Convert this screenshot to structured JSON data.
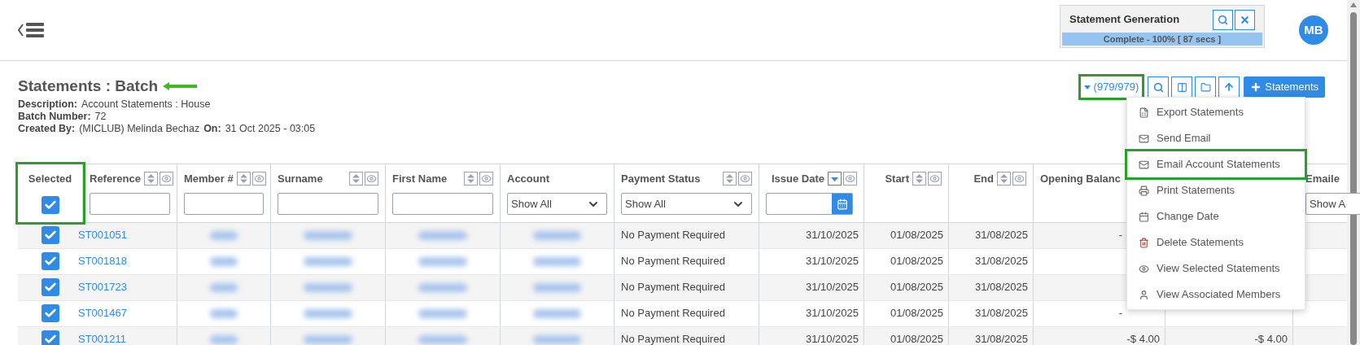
{
  "header": {
    "avatar": "MB",
    "job": {
      "title": "Statement Generation",
      "status": "Complete - 100% [ 87 secs ]",
      "level": 1
    }
  },
  "page": {
    "title": "Statements : Batch",
    "details": [
      {
        "label": "Description:",
        "value": "Account Statements : House"
      },
      {
        "label": "Batch Number:",
        "value": "72"
      },
      {
        "label": "Created By:",
        "value": "(MICLUB) Melinda Bechaz",
        "label2": "On:",
        "value2": "31 Oct 2025 - 03:05"
      }
    ]
  },
  "toolbar": {
    "count": "(979/979)",
    "add_button": "Statements"
  },
  "menu": [
    {
      "kind": "export",
      "label": "Export Statements",
      "highlighted": false
    },
    {
      "kind": "mail",
      "label": "Send Email",
      "highlighted": false
    },
    {
      "kind": "mail",
      "label": "Email Account Statements",
      "highlighted": true
    },
    {
      "kind": "print",
      "label": "Print Statements",
      "highlighted": false
    },
    {
      "kind": "calendar",
      "label": "Change Date",
      "highlighted": false
    },
    {
      "kind": "delete",
      "label": "Delete Statements",
      "highlighted": false
    },
    {
      "kind": "view",
      "label": "View Selected Statements",
      "highlighted": false
    },
    {
      "kind": "user",
      "label": "View Associated Members",
      "highlighted": false
    }
  ],
  "table": {
    "columns": [
      {
        "label": "Selected",
        "kind": "checkbox",
        "checked": true,
        "highlighted": true
      },
      {
        "label": "Reference",
        "kind": "text",
        "sorted": false
      },
      {
        "label": "Member #",
        "kind": "text",
        "sorted": false
      },
      {
        "label": "Surname",
        "kind": "text",
        "sorted": false
      },
      {
        "label": "First Name",
        "kind": "text",
        "sorted": false
      },
      {
        "label": "Account",
        "kind": "select",
        "value": "Show All"
      },
      {
        "label": "Payment Status",
        "kind": "select",
        "value": "Show All",
        "sorted": false
      },
      {
        "label": "Issue Date",
        "kind": "date",
        "sorted": true
      },
      {
        "label": "Start",
        "kind": "plain",
        "sorted": false
      },
      {
        "label": "End",
        "kind": "plain",
        "sorted": false
      },
      {
        "label": "Opening Balanc",
        "kind": "plain"
      },
      {
        "kind": "plain"
      },
      {
        "label": "Emaile",
        "kind": "select-cut",
        "value": "Show A"
      }
    ],
    "rows": [
      {
        "selected": true,
        "reference": "ST001051",
        "redacted": true,
        "payment_status": "No Payment Required",
        "issue_date": "31/10/2025",
        "start": "01/08/2025",
        "end": "31/08/2025",
        "opening_balance": {
          "text": "-",
          "covered": true
        }
      },
      {
        "selected": true,
        "reference": "ST001818",
        "redacted": true,
        "payment_status": "No Payment Required",
        "issue_date": "31/10/2025",
        "start": "01/08/2025",
        "end": "31/08/2025"
      },
      {
        "selected": true,
        "reference": "ST001723",
        "redacted": true,
        "payment_status": "No Payment Required",
        "issue_date": "31/10/2025",
        "start": "01/08/2025",
        "end": "31/08/2025"
      },
      {
        "selected": true,
        "reference": "ST001467",
        "redacted": true,
        "payment_status": "No Payment Required",
        "issue_date": "31/10/2025",
        "start": "01/08/2025",
        "end": "31/08/2025",
        "opening_balance": {
          "text": "-",
          "covered": true
        }
      },
      {
        "selected": true,
        "reference": "ST001211",
        "redacted": true,
        "payment_status": "No Payment Required",
        "issue_date": "31/10/2025",
        "start": "01/08/2025",
        "end": "31/08/2025",
        "opening_balance": {
          "text": "-$ 4.00"
        },
        "column_12": "-$ 4.00"
      }
    ]
  }
}
